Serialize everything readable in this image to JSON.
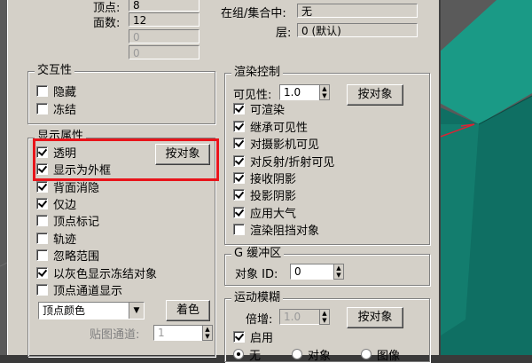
{
  "top": {
    "vertices_label": "顶点:",
    "vertices_value": "8",
    "faces_label": "面数:",
    "faces_value": "12",
    "extra_value_1": "0",
    "extra_value_2": "0",
    "in_group_label": "在组/集合中:",
    "in_group_value": "无",
    "layer_label": "层:",
    "layer_value": "0 (默认)"
  },
  "interaction": {
    "title": "交互性",
    "hide": "隐藏",
    "freeze": "冻结"
  },
  "display": {
    "title": "显示属性",
    "transparent": "透明",
    "show_as_box": "显示为外框",
    "backface_cull": "背面消隐",
    "edges_only": "仅边",
    "vertex_ticks": "顶点标记",
    "trajectory": "轨迹",
    "ignore_extents": "忽略范围",
    "show_frozen_gray": "以灰色显示冻结对象",
    "vertex_channel_display": "顶点通道显示",
    "by_object_button": "按对象",
    "vertex_color_select": "顶点颜色",
    "shaded_button": "着色",
    "map_channel_label": "贴图通道:",
    "map_channel_value": "1"
  },
  "render": {
    "title": "渲染控制",
    "visibility_label": "可见性:",
    "visibility_value": "1.0",
    "by_object_button": "按对象",
    "renderable": "可渲染",
    "inherit_visibility": "继承可见性",
    "visible_to_camera": "对摄影机可见",
    "visible_to_reflection": "对反射/折射可见",
    "receive_shadows": "接收阴影",
    "cast_shadows": "投影阴影",
    "apply_atmospherics": "应用大气",
    "render_occluded": "渲染阻挡对象"
  },
  "gbuffer": {
    "title": "G 缓冲区",
    "object_id_label": "对象 ID:",
    "object_id_value": "0"
  },
  "motion_blur": {
    "title": "运动模糊",
    "multiplier_label": "倍增:",
    "multiplier_value": "1.0",
    "by_object_button": "按对象",
    "enabled": "启用",
    "none": "无",
    "object": "对象",
    "image": "图像"
  },
  "colors": {
    "dialog_bg": "#d4d0c8",
    "highlight_frame": "#e8141a",
    "cube_teal": "#1a9a86",
    "cube_dark": "#0f6f63"
  }
}
